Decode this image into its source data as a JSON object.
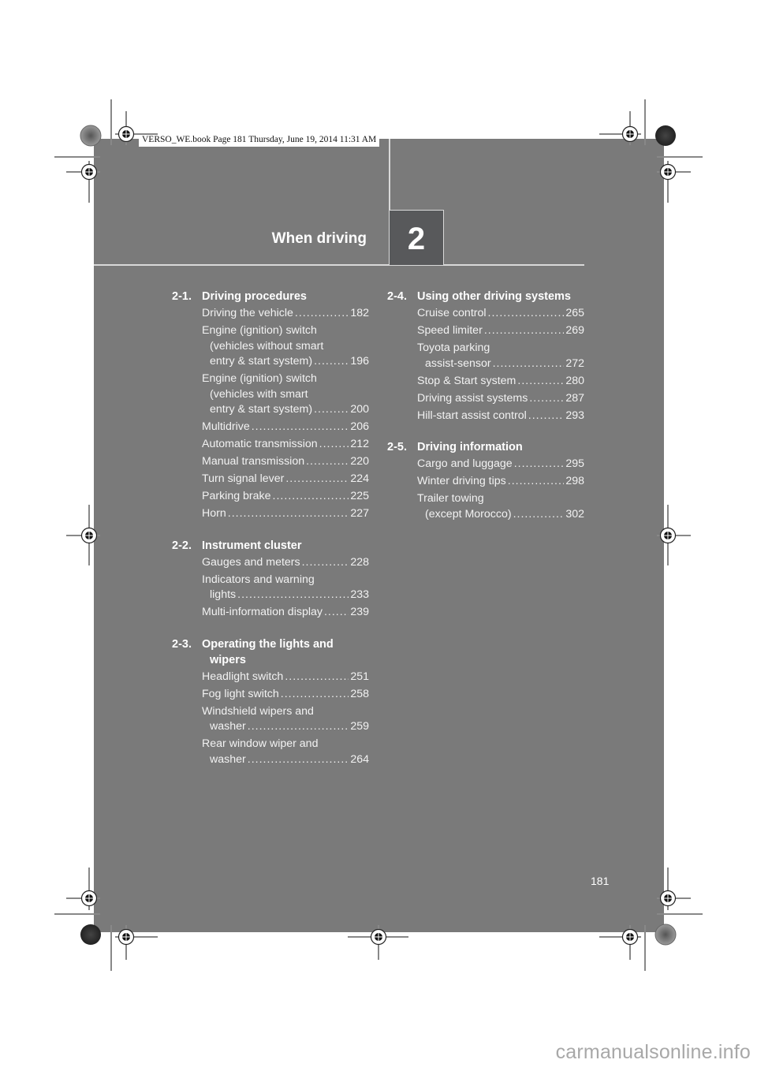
{
  "print_header": "VERSO_WE.book  Page 181  Thursday, June 19, 2014  11:31 AM",
  "chapter": {
    "title": "When driving",
    "number": "2"
  },
  "page_number": "181",
  "watermark": "carmanualsonline.info",
  "colors": {
    "page_bg": "#7a7a7a",
    "chapter_box": "#58595b",
    "rule": "#d9d9d9",
    "text": "#ffffff"
  },
  "toc_left": [
    {
      "num": "2-1.",
      "title": [
        "Driving procedures"
      ],
      "entries": [
        {
          "lines": [
            "Driving the vehicle"
          ],
          "page": "182"
        },
        {
          "lines": [
            "Engine (ignition) switch",
            "(vehicles without smart",
            "entry & start system)"
          ],
          "page": "196"
        },
        {
          "lines": [
            "Engine (ignition) switch",
            "(vehicles with smart",
            "entry & start system)"
          ],
          "page": "200"
        },
        {
          "lines": [
            "Multidrive"
          ],
          "page": "206"
        },
        {
          "lines": [
            "Automatic transmission"
          ],
          "page": "212"
        },
        {
          "lines": [
            "Manual transmission"
          ],
          "page": "220"
        },
        {
          "lines": [
            "Turn signal lever"
          ],
          "page": "224"
        },
        {
          "lines": [
            "Parking brake"
          ],
          "page": "225"
        },
        {
          "lines": [
            "Horn"
          ],
          "page": "227"
        }
      ]
    },
    {
      "num": "2-2.",
      "title": [
        "Instrument cluster"
      ],
      "entries": [
        {
          "lines": [
            "Gauges and meters"
          ],
          "page": "228"
        },
        {
          "lines": [
            "Indicators and warning",
            "lights"
          ],
          "page": "233"
        },
        {
          "lines": [
            "Multi-information display"
          ],
          "page": "239"
        }
      ]
    },
    {
      "num": "2-3.",
      "title": [
        "Operating the lights and",
        "wipers"
      ],
      "entries": [
        {
          "lines": [
            "Headlight switch"
          ],
          "page": "251"
        },
        {
          "lines": [
            "Fog light switch"
          ],
          "page": "258"
        },
        {
          "lines": [
            "Windshield wipers and",
            "washer"
          ],
          "page": "259"
        },
        {
          "lines": [
            "Rear window wiper and",
            "washer"
          ],
          "page": "264"
        }
      ]
    }
  ],
  "toc_right": [
    {
      "num": "2-4.",
      "title": [
        "Using other driving systems"
      ],
      "entries": [
        {
          "lines": [
            "Cruise control"
          ],
          "page": "265"
        },
        {
          "lines": [
            "Speed limiter"
          ],
          "page": "269"
        },
        {
          "lines": [
            "Toyota parking",
            "assist-sensor"
          ],
          "page": "272"
        },
        {
          "lines": [
            "Stop & Start system"
          ],
          "page": "280"
        },
        {
          "lines": [
            "Driving assist systems"
          ],
          "page": "287"
        },
        {
          "lines": [
            "Hill-start assist control"
          ],
          "page": "293"
        }
      ]
    },
    {
      "num": "2-5.",
      "title": [
        "Driving information"
      ],
      "entries": [
        {
          "lines": [
            "Cargo and luggage"
          ],
          "page": "295"
        },
        {
          "lines": [
            "Winter driving tips"
          ],
          "page": "298"
        },
        {
          "lines": [
            "Trailer towing",
            "(except Morocco)"
          ],
          "page": "302"
        }
      ]
    }
  ]
}
